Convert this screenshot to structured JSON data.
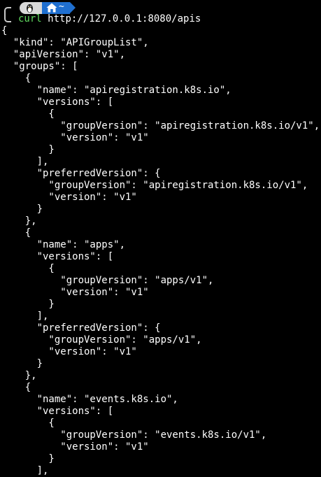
{
  "prompt": {
    "os_icon": "linux-icon",
    "dir_icon": "home-icon",
    "dir_label": "~",
    "accent_color": "#1f6fd0",
    "command_color": "#5fd75f"
  },
  "command": {
    "name": "curl",
    "argument": "http://127.0.0.1:8080/apis"
  },
  "output_lines": [
    "{",
    "  \"kind\": \"APIGroupList\",",
    "  \"apiVersion\": \"v1\",",
    "  \"groups\": [",
    "    {",
    "      \"name\": \"apiregistration.k8s.io\",",
    "      \"versions\": [",
    "        {",
    "          \"groupVersion\": \"apiregistration.k8s.io/v1\",",
    "          \"version\": \"v1\"",
    "        }",
    "      ],",
    "      \"preferredVersion\": {",
    "        \"groupVersion\": \"apiregistration.k8s.io/v1\",",
    "        \"version\": \"v1\"",
    "      }",
    "    },",
    "    {",
    "      \"name\": \"apps\",",
    "      \"versions\": [",
    "        {",
    "          \"groupVersion\": \"apps/v1\",",
    "          \"version\": \"v1\"",
    "        }",
    "      ],",
    "      \"preferredVersion\": {",
    "        \"groupVersion\": \"apps/v1\",",
    "        \"version\": \"v1\"",
    "      }",
    "    },",
    "    {",
    "      \"name\": \"events.k8s.io\",",
    "      \"versions\": [",
    "        {",
    "          \"groupVersion\": \"events.k8s.io/v1\",",
    "          \"version\": \"v1\"",
    "        }",
    "      ],"
  ]
}
